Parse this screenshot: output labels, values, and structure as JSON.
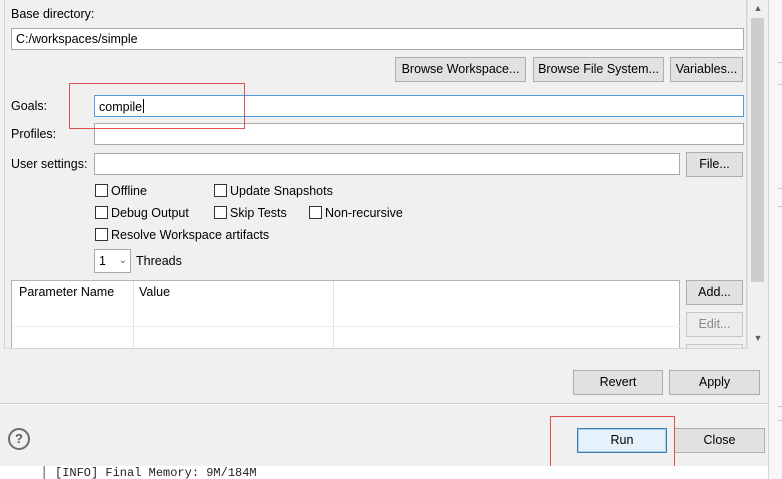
{
  "labels": {
    "base_directory": "Base directory:",
    "goals": "Goals:",
    "profiles": "Profiles:",
    "user_settings": "User settings:",
    "threads": "Threads"
  },
  "fields": {
    "base_directory": "C:/workspaces/simple",
    "goals": "compile",
    "profiles": "",
    "user_settings": ""
  },
  "buttons": {
    "browse_workspace": "Browse Workspace...",
    "browse_file_system": "Browse File System...",
    "variables": "Variables...",
    "file": "File...",
    "add": "Add...",
    "edit": "Edit...",
    "revert": "Revert",
    "apply": "Apply",
    "run": "Run",
    "close": "Close"
  },
  "checkboxes": {
    "offline": "Offline",
    "update_snapshots": "Update Snapshots",
    "debug_output": "Debug Output",
    "skip_tests": "Skip Tests",
    "non_recursive": "Non-recursive",
    "resolve_workspace": "Resolve Workspace artifacts"
  },
  "threads": {
    "value": "1"
  },
  "parameters_table": {
    "columns": [
      "Parameter Name",
      "Value"
    ]
  },
  "help": {
    "symbol": "?"
  },
  "console": {
    "line": "[INFO] Final Memory: 9M/184M"
  },
  "icons": {
    "help": "help-icon",
    "dropdown": "chevron-down-icon",
    "scroll_up": "scroll-up-arrow-icon",
    "scroll_down": "scroll-down-arrow-icon"
  },
  "colors": {
    "highlight_annotation": "#e05050",
    "focus_border": "#4e9be0",
    "default_button_border": "#3c7fb1"
  }
}
